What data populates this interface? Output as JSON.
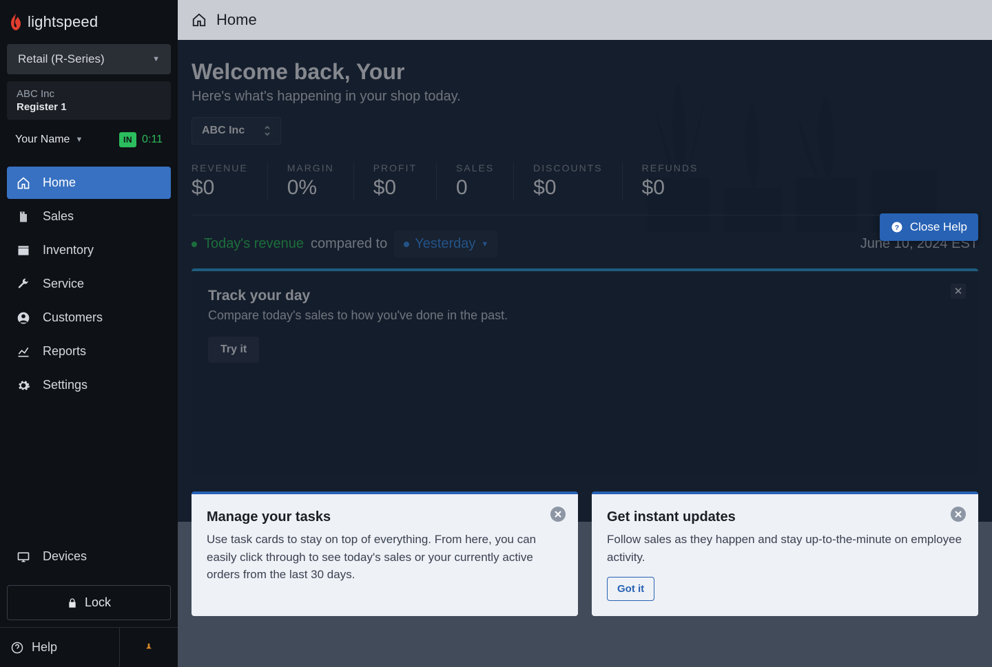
{
  "brand": {
    "name": "lightspeed"
  },
  "sidebar": {
    "product_select": "Retail (R-Series)",
    "company": "ABC Inc",
    "register": "Register 1",
    "user_name": "Your Name",
    "in_badge": "IN",
    "timer": "0:11",
    "nav": [
      {
        "label": "Home"
      },
      {
        "label": "Sales"
      },
      {
        "label": "Inventory"
      },
      {
        "label": "Service"
      },
      {
        "label": "Customers"
      },
      {
        "label": "Reports"
      },
      {
        "label": "Settings"
      }
    ],
    "devices": "Devices",
    "lock": "Lock",
    "help": "Help"
  },
  "topbar": {
    "crumb": "Home"
  },
  "hero": {
    "title": "Welcome back, Your",
    "subtitle": "Here's what's happening in your shop today.",
    "shop": "ABC Inc"
  },
  "kpis": [
    {
      "label": "REVENUE",
      "value": "$0"
    },
    {
      "label": "MARGIN",
      "value": "0%"
    },
    {
      "label": "PROFIT",
      "value": "$0"
    },
    {
      "label": "SALES",
      "value": "0"
    },
    {
      "label": "DISCOUNTS",
      "value": "$0"
    },
    {
      "label": "REFUNDS",
      "value": "$0"
    }
  ],
  "close_help": "Close Help",
  "compare": {
    "revenue": "Today's revenue",
    "compared_to": "compared to",
    "yesterday": "Yesterday",
    "date": "June 10, 2024 EST"
  },
  "track_card": {
    "title": "Track your day",
    "body": "Compare today's sales to how you've done in the past.",
    "cta": "Try it"
  },
  "tasks_card": {
    "title": "Manage your tasks",
    "body": "Use task cards to stay on top of everything. From here, you can easily click through to see today's sales or your currently active orders from the last 30 days."
  },
  "updates_card": {
    "title": "Get instant updates",
    "body": "Follow sales as they happen and stay up-to-the-minute on employee activity.",
    "cta": "Got it"
  }
}
